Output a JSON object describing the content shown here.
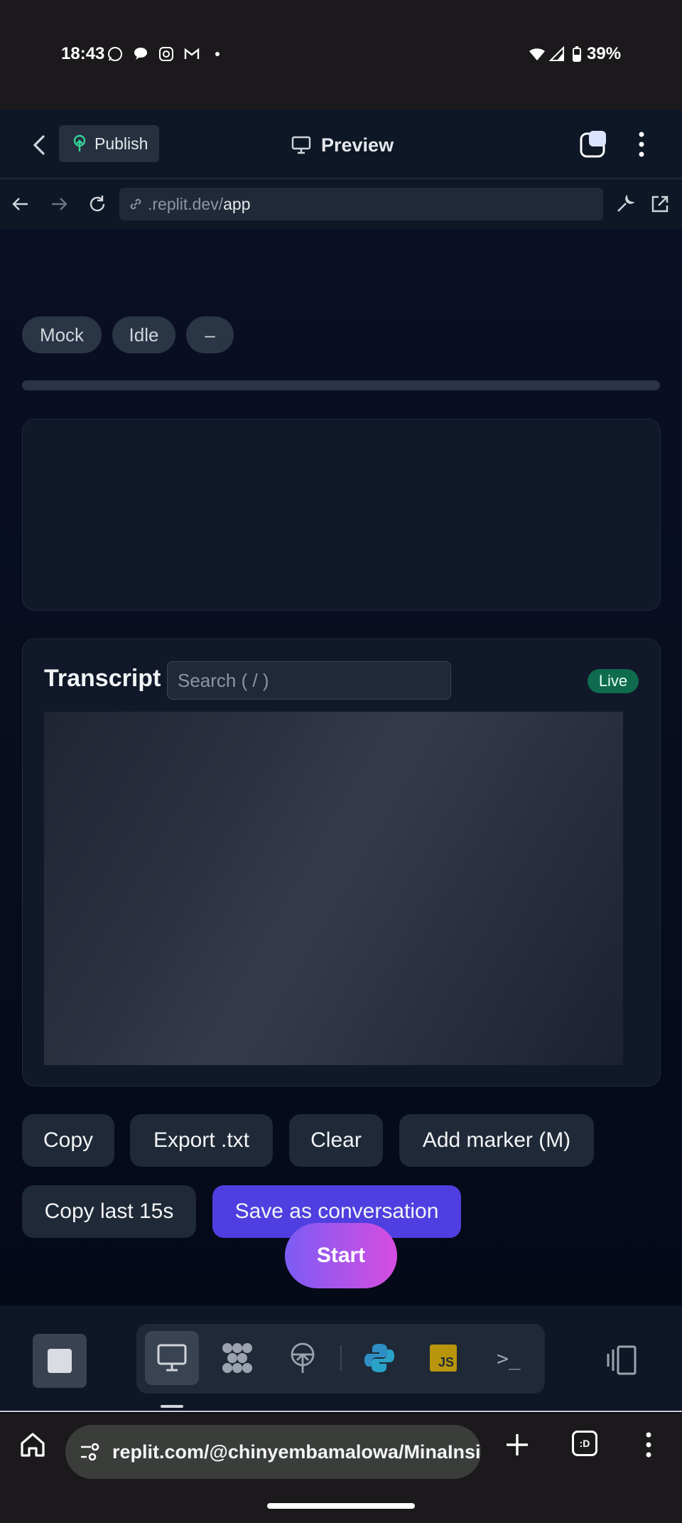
{
  "status_bar": {
    "time": "18:43",
    "battery": "39%"
  },
  "top_bar": {
    "publish_label": "Publish",
    "preview_label": "Preview"
  },
  "url_bar": {
    "url_prefix": ".replit.dev/",
    "url_path": "app"
  },
  "app": {
    "status_pills": [
      "Mock",
      "Idle",
      "–"
    ],
    "transcript": {
      "title": "Transcript",
      "search_placeholder": "Search ( / )",
      "live_badge": "Live"
    },
    "actions": {
      "copy": "Copy",
      "export": "Export .txt",
      "clear": "Clear",
      "add_marker": "Add marker (M)",
      "copy_last": "Copy last 15s",
      "save_conversation": "Save as conversation"
    },
    "start_label": "Start"
  },
  "bottom_toolbar": {
    "tools": [
      "preview-icon",
      "shell-icon",
      "deploy-icon",
      "python-icon",
      "javascript-icon",
      "console-icon"
    ],
    "js_label": "JS",
    "console_label": ">_"
  },
  "chrome": {
    "omnibox_text": "replit.com/@chinyembamalowa/MinaInsi",
    "tab_switch_label": ":D"
  },
  "colors": {
    "accent_purple": "#4f3fe0",
    "start_gradient_start": "#7b5cf5",
    "start_gradient_end": "#d74de0",
    "live_green": "#0f6b4e",
    "background": "#050a19"
  }
}
